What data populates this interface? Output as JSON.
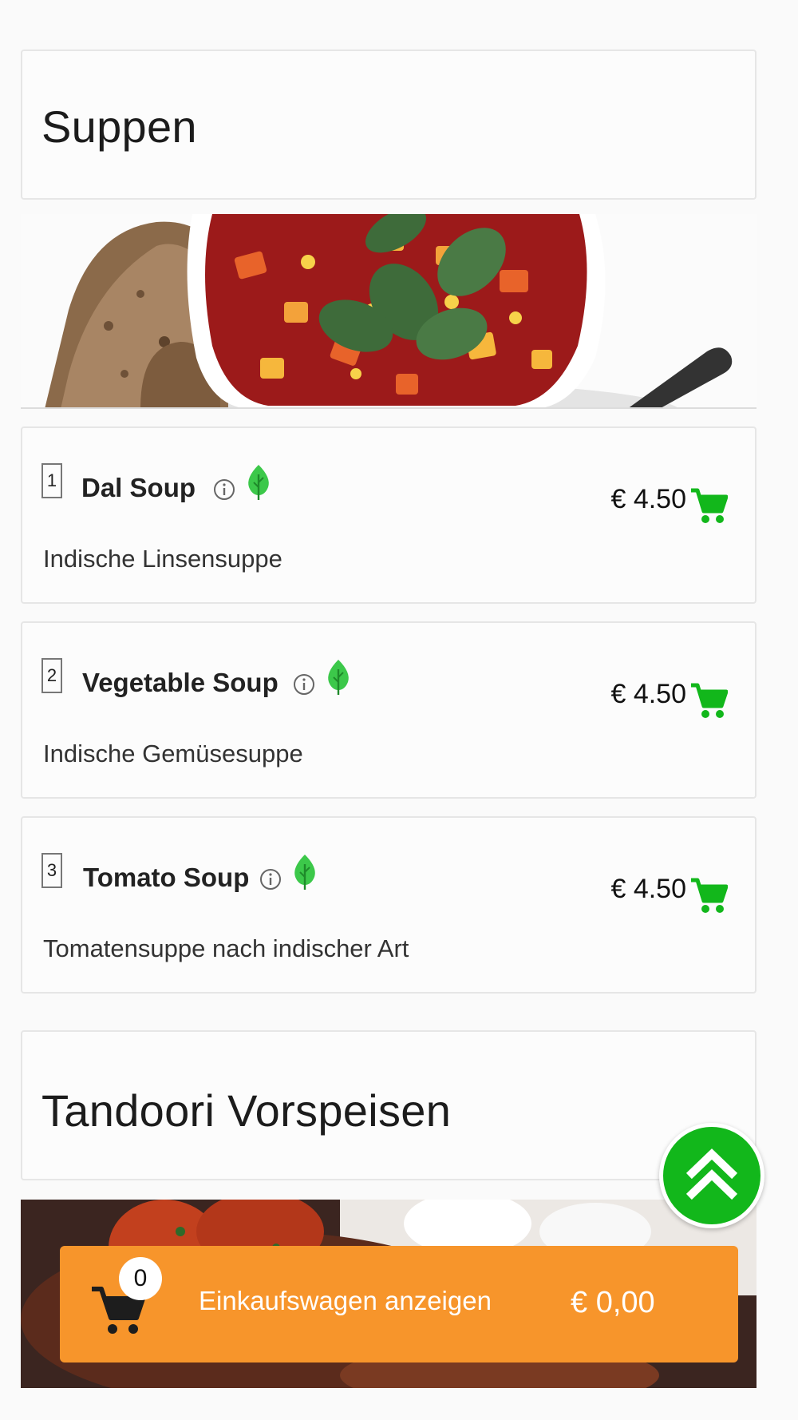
{
  "sections": [
    {
      "title": "Suppen"
    },
    {
      "title": "Tandoori Vorspeisen"
    }
  ],
  "items": [
    {
      "number": "1",
      "name": "Dal Soup",
      "price": "€ 4.50",
      "description": "Indische Linsensuppe"
    },
    {
      "number": "2",
      "name": "Vegetable Soup",
      "price": "€ 4.50",
      "description": "Indische Gemüsesuppe"
    },
    {
      "number": "3",
      "name": "Tomato Soup",
      "price": "€ 4.50",
      "description": "Tomatensuppe nach indischer Art"
    }
  ],
  "cart": {
    "count": "0",
    "label": "Einkaufswagen anzeigen",
    "total": "€ 0,00"
  },
  "colors": {
    "accent_green": "#12b71b",
    "cart_bar": "#f7952b",
    "leaf": "#3cc84a"
  },
  "icons": {
    "info": "info-icon",
    "vegetarian": "leaf-icon",
    "add_to_cart": "cart-icon",
    "scroll_top": "double-chevron-up-icon"
  }
}
